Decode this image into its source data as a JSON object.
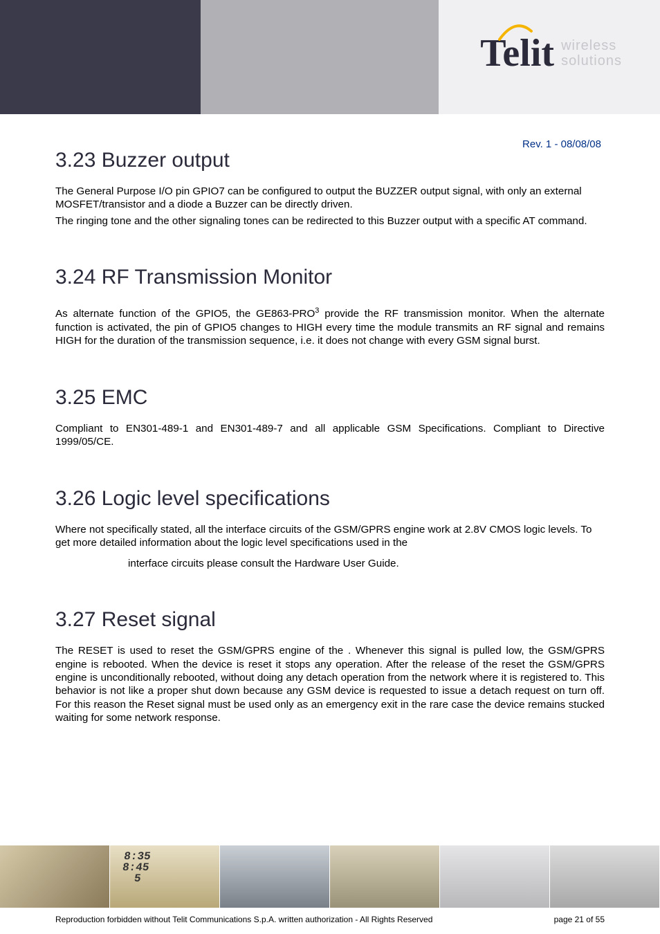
{
  "logo": {
    "brand": "Telit",
    "tagline1": "wireless",
    "tagline2": "solutions"
  },
  "revision": "Rev. 1 - 08/08/08",
  "sections": {
    "s323": {
      "heading": "3.23   Buzzer output",
      "p1": "The General Purpose I/O pin GPIO7 can be configured to output the BUZZER output signal, with only an external MOSFET/transistor and a diode a Buzzer can be directly driven.",
      "p2": "The ringing tone and the other signaling tones can be redirected to this Buzzer output with a specific AT command."
    },
    "s324": {
      "heading": "3.24   RF Transmission Monitor",
      "p1a": "As alternate function of the GPIO5, the GE863-PRO",
      "sup": "3",
      "p1b": " provide the RF transmission monitor. When the alternate function is activated, the pin of GPIO5 changes to HIGH every time the module transmits an RF signal and remains HIGH for the duration of the transmission sequence, i.e. it does not change with every GSM signal burst."
    },
    "s325": {
      "heading": "3.25   EMC",
      "p1": "Compliant to EN301-489-1 and EN301-489-7 and all applicable GSM Specifications. Compliant to Directive 1999/05/CE."
    },
    "s326": {
      "heading": "3.26   Logic level specifications",
      "p1": "Where not specifically stated, all the interface circuits of the GSM/GPRS engine work at 2.8V CMOS logic levels. To get more detailed information about the logic level specifications used in the",
      "p2": "interface circuits please consult  the Hardware User Guide."
    },
    "s327": {
      "heading": "3.27   Reset signal",
      "p1": "The RESET is used to reset the GSM/GPRS engine of the                                        . Whenever this signal is pulled low, the GSM/GPRS engine is rebooted. When the device is reset it stops any operation. After the release of the reset the GSM/GPRS engine is unconditionally rebooted, without doing any detach operation from the network where it is registered to. This behavior is not like a proper shut down because any GSM device is requested to issue a detach request on turn off. For this reason the Reset signal must be used only as an emergency exit in the rare case the device remains stucked waiting for some network response."
    }
  },
  "footer": {
    "copyright": "Reproduction forbidden without Telit Communications S.p.A. written authorization - All Rights Reserved",
    "page": "page 21 of 55"
  },
  "decor": {
    "clock_lines": "8:35\n8:45\n  5"
  }
}
